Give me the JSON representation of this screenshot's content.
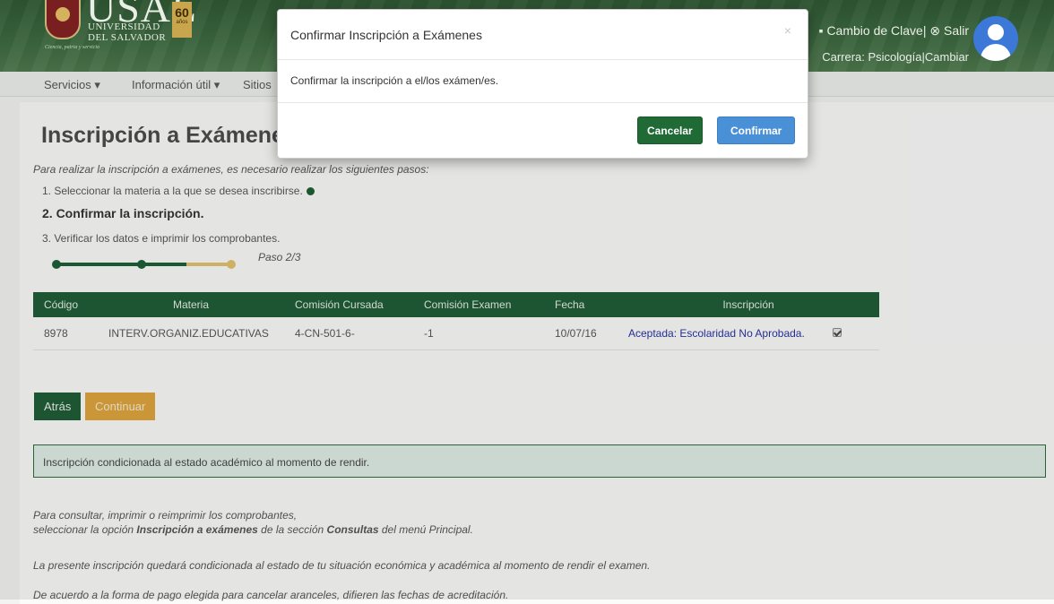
{
  "header": {
    "logo_short": "USAL",
    "logo_line1": "UNIVERSIDAD",
    "logo_line2": "DEL SALVADOR",
    "logo_motto": "Ciencia, patria y servicio",
    "anniversary_number": "60",
    "anniversary_word": "años",
    "change_password": "Cambio de Clave",
    "logout": "Salir",
    "career_label": "Carrera: Psicología",
    "change_career": "Cambiar"
  },
  "nav": {
    "items": [
      "Servicios ▾",
      "Información útil ▾",
      "Sitios"
    ]
  },
  "page": {
    "title": "Inscripción a Exámenes",
    "intro": "Para realizar la inscripción a exámenes, es necesario realizar los siguientes pasos:",
    "steps": [
      "1. Seleccionar la materia a la que se desea inscribirse.",
      "2. Confirmar la inscripción.",
      "3. Verificar los datos e imprimir los comprobantes."
    ],
    "progress_label": "Paso 2/3",
    "progress_step": 2,
    "progress_total": 3
  },
  "table": {
    "headers": [
      "Código",
      "Materia",
      "Comisión Cursada",
      "Comisión Examen",
      "Fecha",
      "Inscripción"
    ],
    "rows": [
      {
        "codigo": "8978",
        "materia": "INTERV.ORGANIZ.EDUCATIVAS",
        "comision_cursada": "4-CN-501-6-",
        "comision_examen": "-1",
        "fecha": "10/07/16",
        "inscripcion": "Aceptada: Escolaridad No Aprobada.",
        "checked": true
      }
    ]
  },
  "buttons": {
    "back": "Atrás",
    "continue": "Continuar"
  },
  "alert": "Inscripción condicionada al estado académico al momento de rendir.",
  "notes": {
    "n1": "Para consultar, imprimir o reimprimir los comprobantes,",
    "n2_a": "seleccionar la opción ",
    "n2_b": "Inscripción a exámenes",
    "n2_c": " de la sección ",
    "n2_d": "Consultas",
    "n2_e": " del menú Principal.",
    "n3": "La presente inscripción quedará condicionada al estado de tu situación económica y académica al momento de rendir el examen.",
    "n4": "De acuerdo a la forma de pago elegida para cancelar aranceles, difieren las fechas de acreditación."
  },
  "modal": {
    "title": "Confirmar Inscripción a Exámenes",
    "close": "×",
    "body": "Confirmar la inscripción a el/los exámen/es.",
    "cancel": "Cancelar",
    "confirm": "Confirmar"
  }
}
